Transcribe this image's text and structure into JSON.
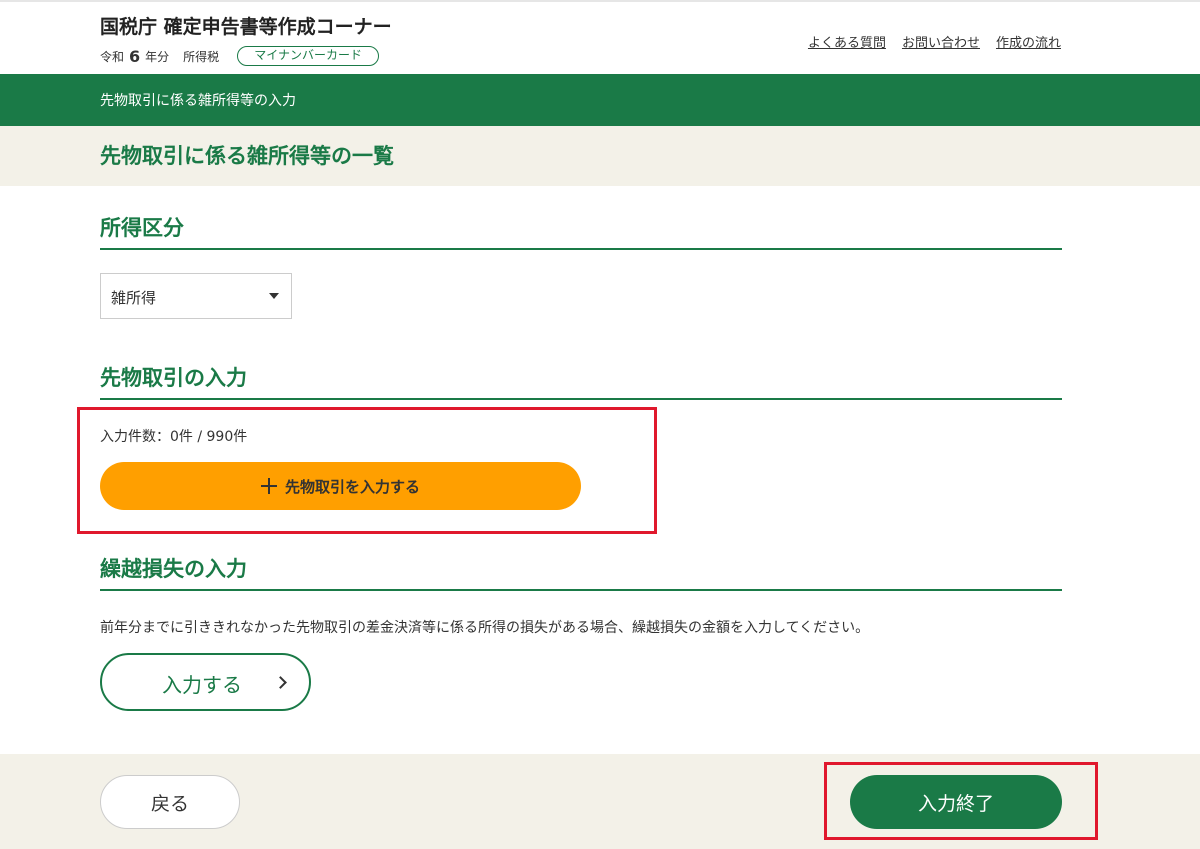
{
  "header": {
    "title": "国税庁 確定申告書等作成コーナー",
    "era": "令和",
    "year": "6",
    "year_suffix": "年分",
    "tax_type": "所得税",
    "badge": "マイナンバーカード",
    "links": [
      "よくある質問",
      "お問い合わせ",
      "作成の流れ"
    ]
  },
  "breadcrumb": "先物取引に係る雑所得等の入力",
  "page_title": "先物取引に係る雑所得等の一覧",
  "income_category": {
    "heading": "所得区分",
    "selected": "雑所得"
  },
  "futures": {
    "heading": "先物取引の入力",
    "count_text": "入力件数：0件 / 990件",
    "add_button": "先物取引を入力する"
  },
  "carryover": {
    "heading": "繰越損失の入力",
    "description": "前年分までに引ききれなかった先物取引の差金決済等に係る所得の損失がある場合、繰越損失の金額を入力してください。",
    "button": "入力する"
  },
  "footer": {
    "back": "戻る",
    "finish": "入力終了"
  },
  "colors": {
    "brand_green": "#1a7a47",
    "accent_orange": "#ff9f00",
    "highlight_red": "#e0182d",
    "beige": "#f3f1e8"
  }
}
